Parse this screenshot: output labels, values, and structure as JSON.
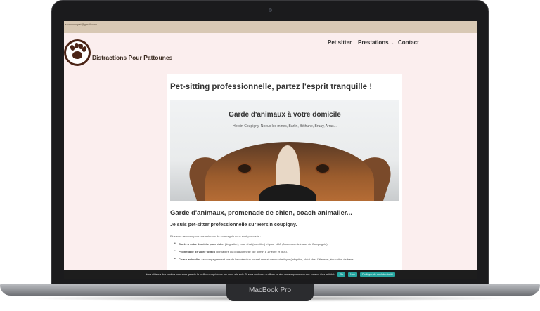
{
  "device": {
    "model_label": "MacBook Pro"
  },
  "topbar": {
    "email": "aaraxxxxxpat@gmail.com"
  },
  "site": {
    "title": "Distractions Pour Pattounes"
  },
  "nav": {
    "items": [
      "Pet sitter",
      "Prestations",
      "Contact"
    ],
    "dropdown_indicator": "⌄"
  },
  "page": {
    "h1": "Pet-sitting professionnelle, partez l'esprit tranquille !",
    "hero": {
      "title": "Garde d'animaux à votre domicile",
      "subtitle": "Hersin-Coupigny, Noeux les mines, Barlin, Béthune, Bruay, Arras..."
    },
    "h2": "Garde d'animaux, promenade de chien, coach animalier...",
    "h3": {
      "prefix": "Je suis ",
      "bold": "pet-sitter professionnelle",
      "suffix": " sur Hersin coupigny."
    },
    "intro": "Plusieurs services pour vos animaux de compagnie vous sont proposés :",
    "services": [
      {
        "bold": "Garde à votre domicile pour chien",
        "text": " (dog-sitter), pour chat (cat-sitter) et pour NAC (Nouveaux Animaux de Compagnie)."
      },
      {
        "bold": "Promenade de votre toutou",
        "text": " journalière ou occasionnelle (de 30min à 1 heure et plus)."
      },
      {
        "bold": "Coach animalier",
        "text": " : accompagnement lors de l'arrivée d'un nouvel animal dans votre foyer (adoption, chiot chez l'éleveur), éducation de base."
      }
    ]
  },
  "cookie_banner": {
    "text": "Nous utilisons des cookies pour vous garantir la meilleure expérience sur notre site web. Si vous continuez à utiliser ce site, nous supposerons que vous en êtes satisfait.",
    "ok_label": "Ok",
    "no_label": "Non",
    "policy_label": "Politique de confidentialité"
  },
  "colors": {
    "brand_brown": "#4b2416",
    "background_pink": "#fbeeee",
    "topbar": "#d8c8b4",
    "cookie_button": "#27a6a0"
  }
}
